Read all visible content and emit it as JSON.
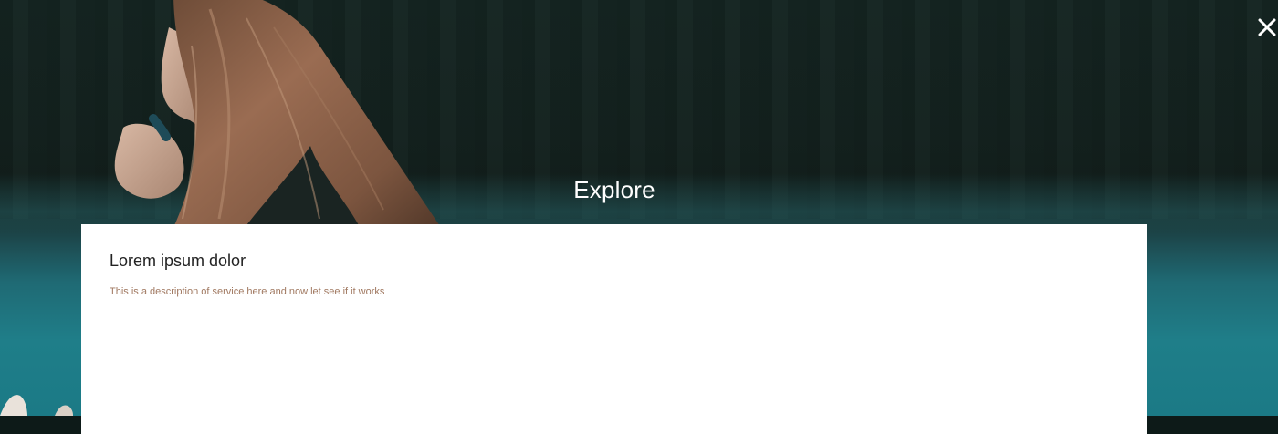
{
  "hero": {
    "title": "Explore"
  },
  "card": {
    "title": "Lorem ipsum dolor",
    "description": "This is a description of service here and now let see if it works"
  },
  "icons": {
    "close": "close-icon"
  },
  "colors": {
    "hero_title": "#ffffff",
    "card_background": "#ffffff",
    "card_title": "#222222",
    "card_description": "#a07860",
    "water_teal": "#1f7e89",
    "forest_dark": "#14221f"
  }
}
